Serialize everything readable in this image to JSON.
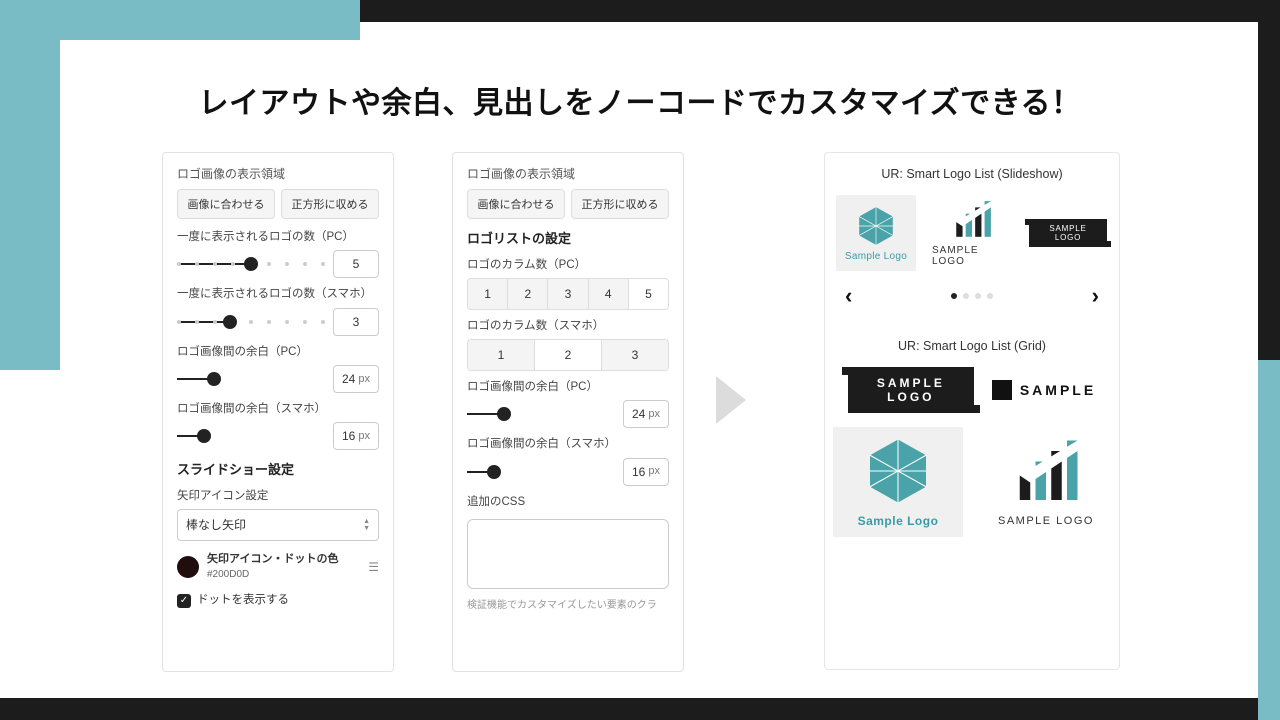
{
  "headline": "レイアウトや余白、見出しをノーコードでカスタマイズできる！",
  "panel1": {
    "region_label": "ロゴ画像の表示領域",
    "fit_image": "画像に合わせる",
    "fit_square": "正方形に収める",
    "count_pc_label": "一度に表示されるロゴの数（PC）",
    "count_pc": "5",
    "count_sp_label": "一度に表示されるロゴの数（スマホ）",
    "count_sp": "3",
    "gap_pc_label": "ロゴ画像間の余白（PC）",
    "gap_pc": "24",
    "gap_sp_label": "ロゴ画像間の余白（スマホ）",
    "gap_sp": "16",
    "px": "px",
    "slideshow_heading": "スライドショー設定",
    "arrow_label": "矢印アイコン設定",
    "arrow_value": "棒なし矢印",
    "color_label": "矢印アイコン・ドットの色",
    "color_hex": "#200D0D",
    "show_dots": "ドットを表示する"
  },
  "panel2": {
    "region_label": "ロゴ画像の表示領域",
    "fit_image": "画像に合わせる",
    "fit_square": "正方形に収める",
    "list_heading": "ロゴリストの設定",
    "cols_pc_label": "ロゴのカラム数（PC）",
    "cols_pc_opts": [
      "1",
      "2",
      "3",
      "4",
      "5"
    ],
    "cols_pc_sel": "5",
    "cols_sp_label": "ロゴのカラム数（スマホ）",
    "cols_sp_opts": [
      "1",
      "2",
      "3"
    ],
    "cols_sp_sel": "2",
    "gap_pc_label": "ロゴ画像間の余白（PC）",
    "gap_pc": "24",
    "gap_sp_label": "ロゴ画像間の余白（スマホ）",
    "gap_sp": "16",
    "px": "px",
    "css_label": "追加のCSS",
    "hint": "検証機能でカスタマイズしたい要素のクラ"
  },
  "preview": {
    "slideshow_title": "UR: Smart Logo List (Slideshow)",
    "grid_title": "UR: Smart Logo List (Grid)",
    "sample_logo": "Sample Logo",
    "sample_logo_caps": "SAMPLE LOGO",
    "sample_badge_l1": "SAMPLE",
    "sample_badge_l2": "LOGO",
    "sample_text": "SAMPLE"
  }
}
